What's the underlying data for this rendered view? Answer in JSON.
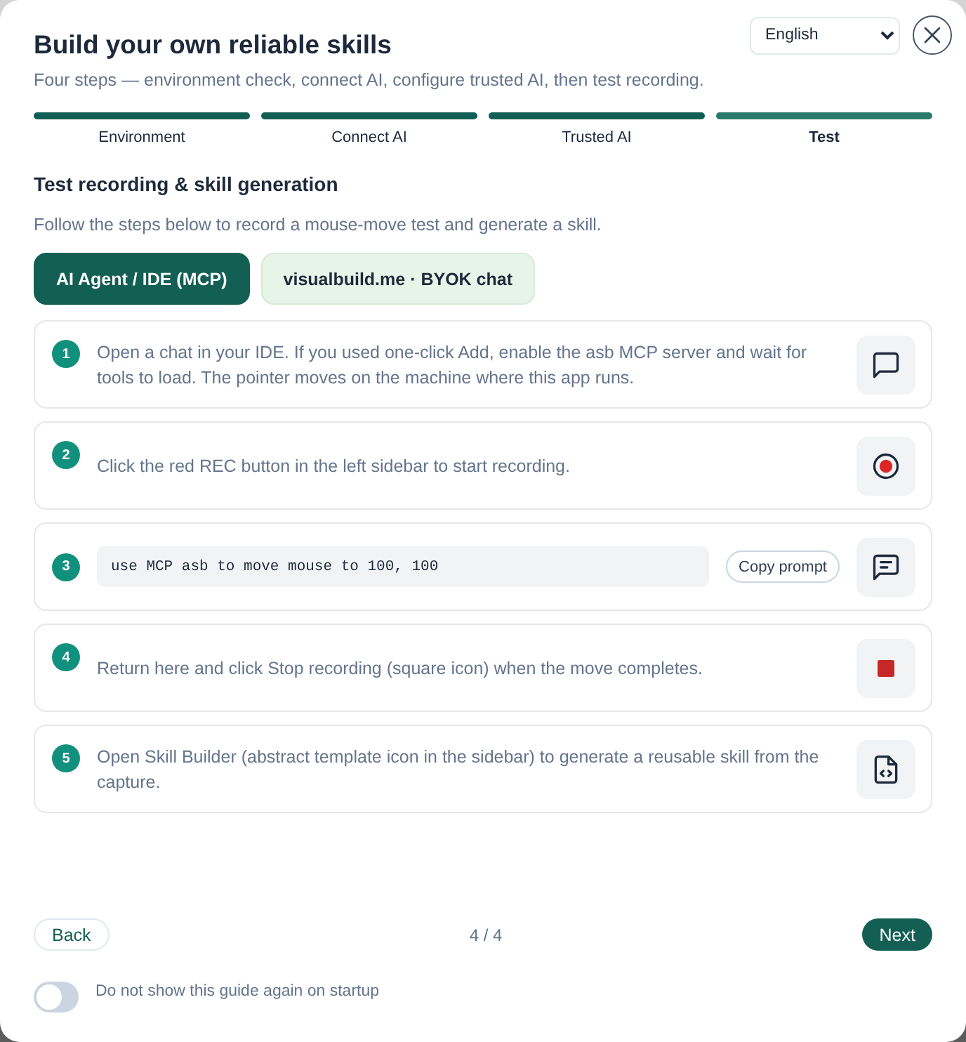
{
  "window": {
    "title": "Build your own reliable skills",
    "subtitle": "Four steps — environment check, connect AI, configure trusted AI, then test recording.",
    "language": "English"
  },
  "progress": [
    {
      "label": "Environment",
      "completed": true,
      "selected": false
    },
    {
      "label": "Connect AI",
      "completed": true,
      "selected": false
    },
    {
      "label": "Trusted AI",
      "completed": true,
      "selected": false
    },
    {
      "label": "Test",
      "completed": false,
      "selected": true
    }
  ],
  "section": {
    "title": "Test recording & skill generation",
    "description": "Follow the steps below to record a mouse-move test and generate a skill."
  },
  "tabs": [
    {
      "label": "AI Agent / IDE (MCP)",
      "selected": true
    },
    {
      "label": "visualbuild.me · BYOK chat",
      "selected": false
    }
  ],
  "steps": [
    {
      "number": "1",
      "kind": "text",
      "text": "Open a chat in your IDE. If you used one-click Add, enable the asb MCP server and wait for tools to load. The pointer moves on the machine where this app runs."
    },
    {
      "number": "2",
      "kind": "text",
      "text": "Click the red REC button in the left sidebar to start recording."
    },
    {
      "number": "3",
      "kind": "prompt",
      "prompt": "use MCP asb to move mouse to 100, 100",
      "button": "Copy prompt"
    },
    {
      "number": "4",
      "kind": "text",
      "text": "Return here and click Stop recording (square icon) when the move completes."
    },
    {
      "number": "5",
      "kind": "text",
      "text": "Open Skill Builder (abstract template icon in the sidebar) to generate a reusable skill from the capture."
    }
  ],
  "footer": {
    "back": "Back",
    "page": "4 / 4",
    "next": "Next"
  },
  "toggle": {
    "label": "Do not show this guide again on startup",
    "on": false
  }
}
